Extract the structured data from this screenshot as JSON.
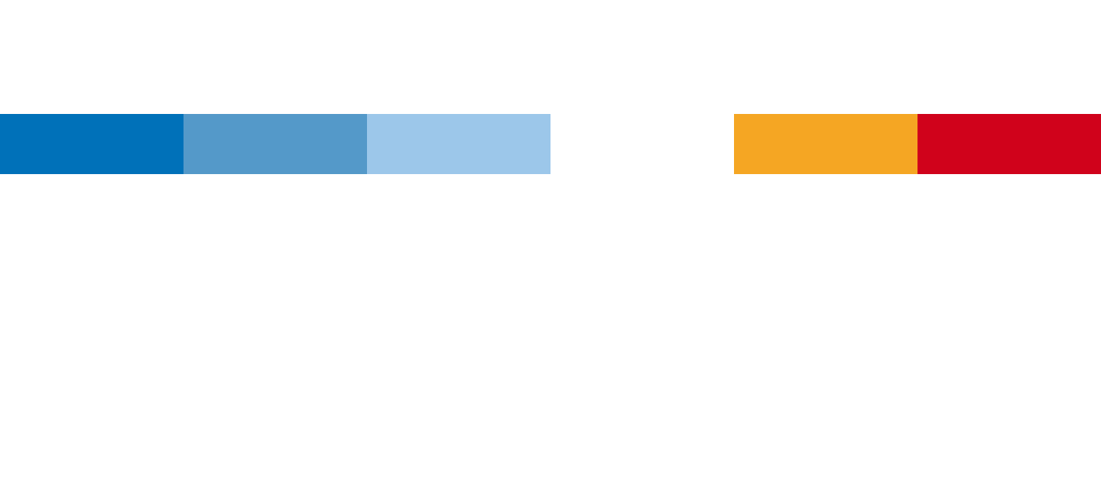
{
  "color_scale": {
    "swatches": [
      {
        "color": "#0071B9"
      },
      {
        "color": "#5499C9"
      },
      {
        "color": "#9CC7EA"
      },
      {
        "color": "#FFFFFF"
      },
      {
        "color": "#F5A623"
      },
      {
        "color": "#D0021B"
      }
    ]
  }
}
